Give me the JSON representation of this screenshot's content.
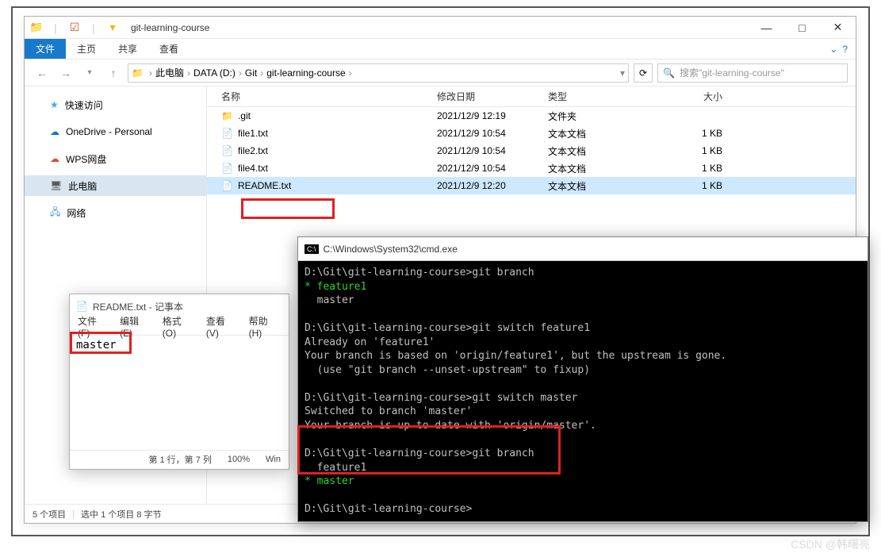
{
  "explorer": {
    "title": "git-learning-course",
    "tabs": {
      "file": "文件",
      "home": "主页",
      "share": "共享",
      "view": "查看"
    },
    "breadcrumb": [
      "此电脑",
      "DATA (D:)",
      "Git",
      "git-learning-course"
    ],
    "search_placeholder": "搜索\"git-learning-course\"",
    "columns": {
      "name": "名称",
      "date": "修改日期",
      "type": "类型",
      "size": "大小"
    },
    "sidebar": {
      "quick": "快速访问",
      "onedrive": "OneDrive - Personal",
      "wps": "WPS网盘",
      "thispc": "此电脑",
      "network": "网络"
    },
    "files": [
      {
        "name": ".git",
        "date": "2021/12/9 12:19",
        "type": "文件夹",
        "size": "",
        "icon": "folder"
      },
      {
        "name": "file1.txt",
        "date": "2021/12/9 10:54",
        "type": "文本文档",
        "size": "1 KB",
        "icon": "txt"
      },
      {
        "name": "file2.txt",
        "date": "2021/12/9 10:54",
        "type": "文本文档",
        "size": "1 KB",
        "icon": "txt"
      },
      {
        "name": "file4.txt",
        "date": "2021/12/9 10:54",
        "type": "文本文档",
        "size": "1 KB",
        "icon": "txt"
      },
      {
        "name": "README.txt",
        "date": "2021/12/9 12:20",
        "type": "文本文档",
        "size": "1 KB",
        "icon": "txt",
        "selected": true
      }
    ],
    "status": {
      "count": "5 个项目",
      "selection": "选中 1 个项目 8 字节"
    }
  },
  "notepad": {
    "title": "README.txt - 记事本",
    "menu": {
      "file": "文件(F)",
      "edit": "编辑(E)",
      "format": "格式(O)",
      "view": "查看(V)",
      "help": "帮助(H)"
    },
    "content": "master",
    "status_pos": "第 1 行，第 7 列",
    "status_zoom": "100%",
    "status_enc": "Win"
  },
  "cmd": {
    "title": "C:\\Windows\\System32\\cmd.exe",
    "lines": [
      {
        "t": "D:\\Git\\git-learning-course>git branch"
      },
      {
        "t": "* feature1",
        "c": "green"
      },
      {
        "t": "  master"
      },
      {
        "t": ""
      },
      {
        "t": "D:\\Git\\git-learning-course>git switch feature1"
      },
      {
        "t": "Already on 'feature1'"
      },
      {
        "t": "Your branch is based on 'origin/feature1', but the upstream is gone."
      },
      {
        "t": "  (use \"git branch --unset-upstream\" to fixup)"
      },
      {
        "t": ""
      },
      {
        "t": "D:\\Git\\git-learning-course>git switch master"
      },
      {
        "t": "Switched to branch 'master'"
      },
      {
        "t": "Your branch is up to date with 'origin/master'."
      },
      {
        "t": ""
      },
      {
        "t": "D:\\Git\\git-learning-course>git branch"
      },
      {
        "t": "  feature1"
      },
      {
        "t": "* master",
        "c": "green"
      },
      {
        "t": ""
      },
      {
        "t": "D:\\Git\\git-learning-course>"
      }
    ]
  },
  "watermark": "CSDN @韩曙亮"
}
